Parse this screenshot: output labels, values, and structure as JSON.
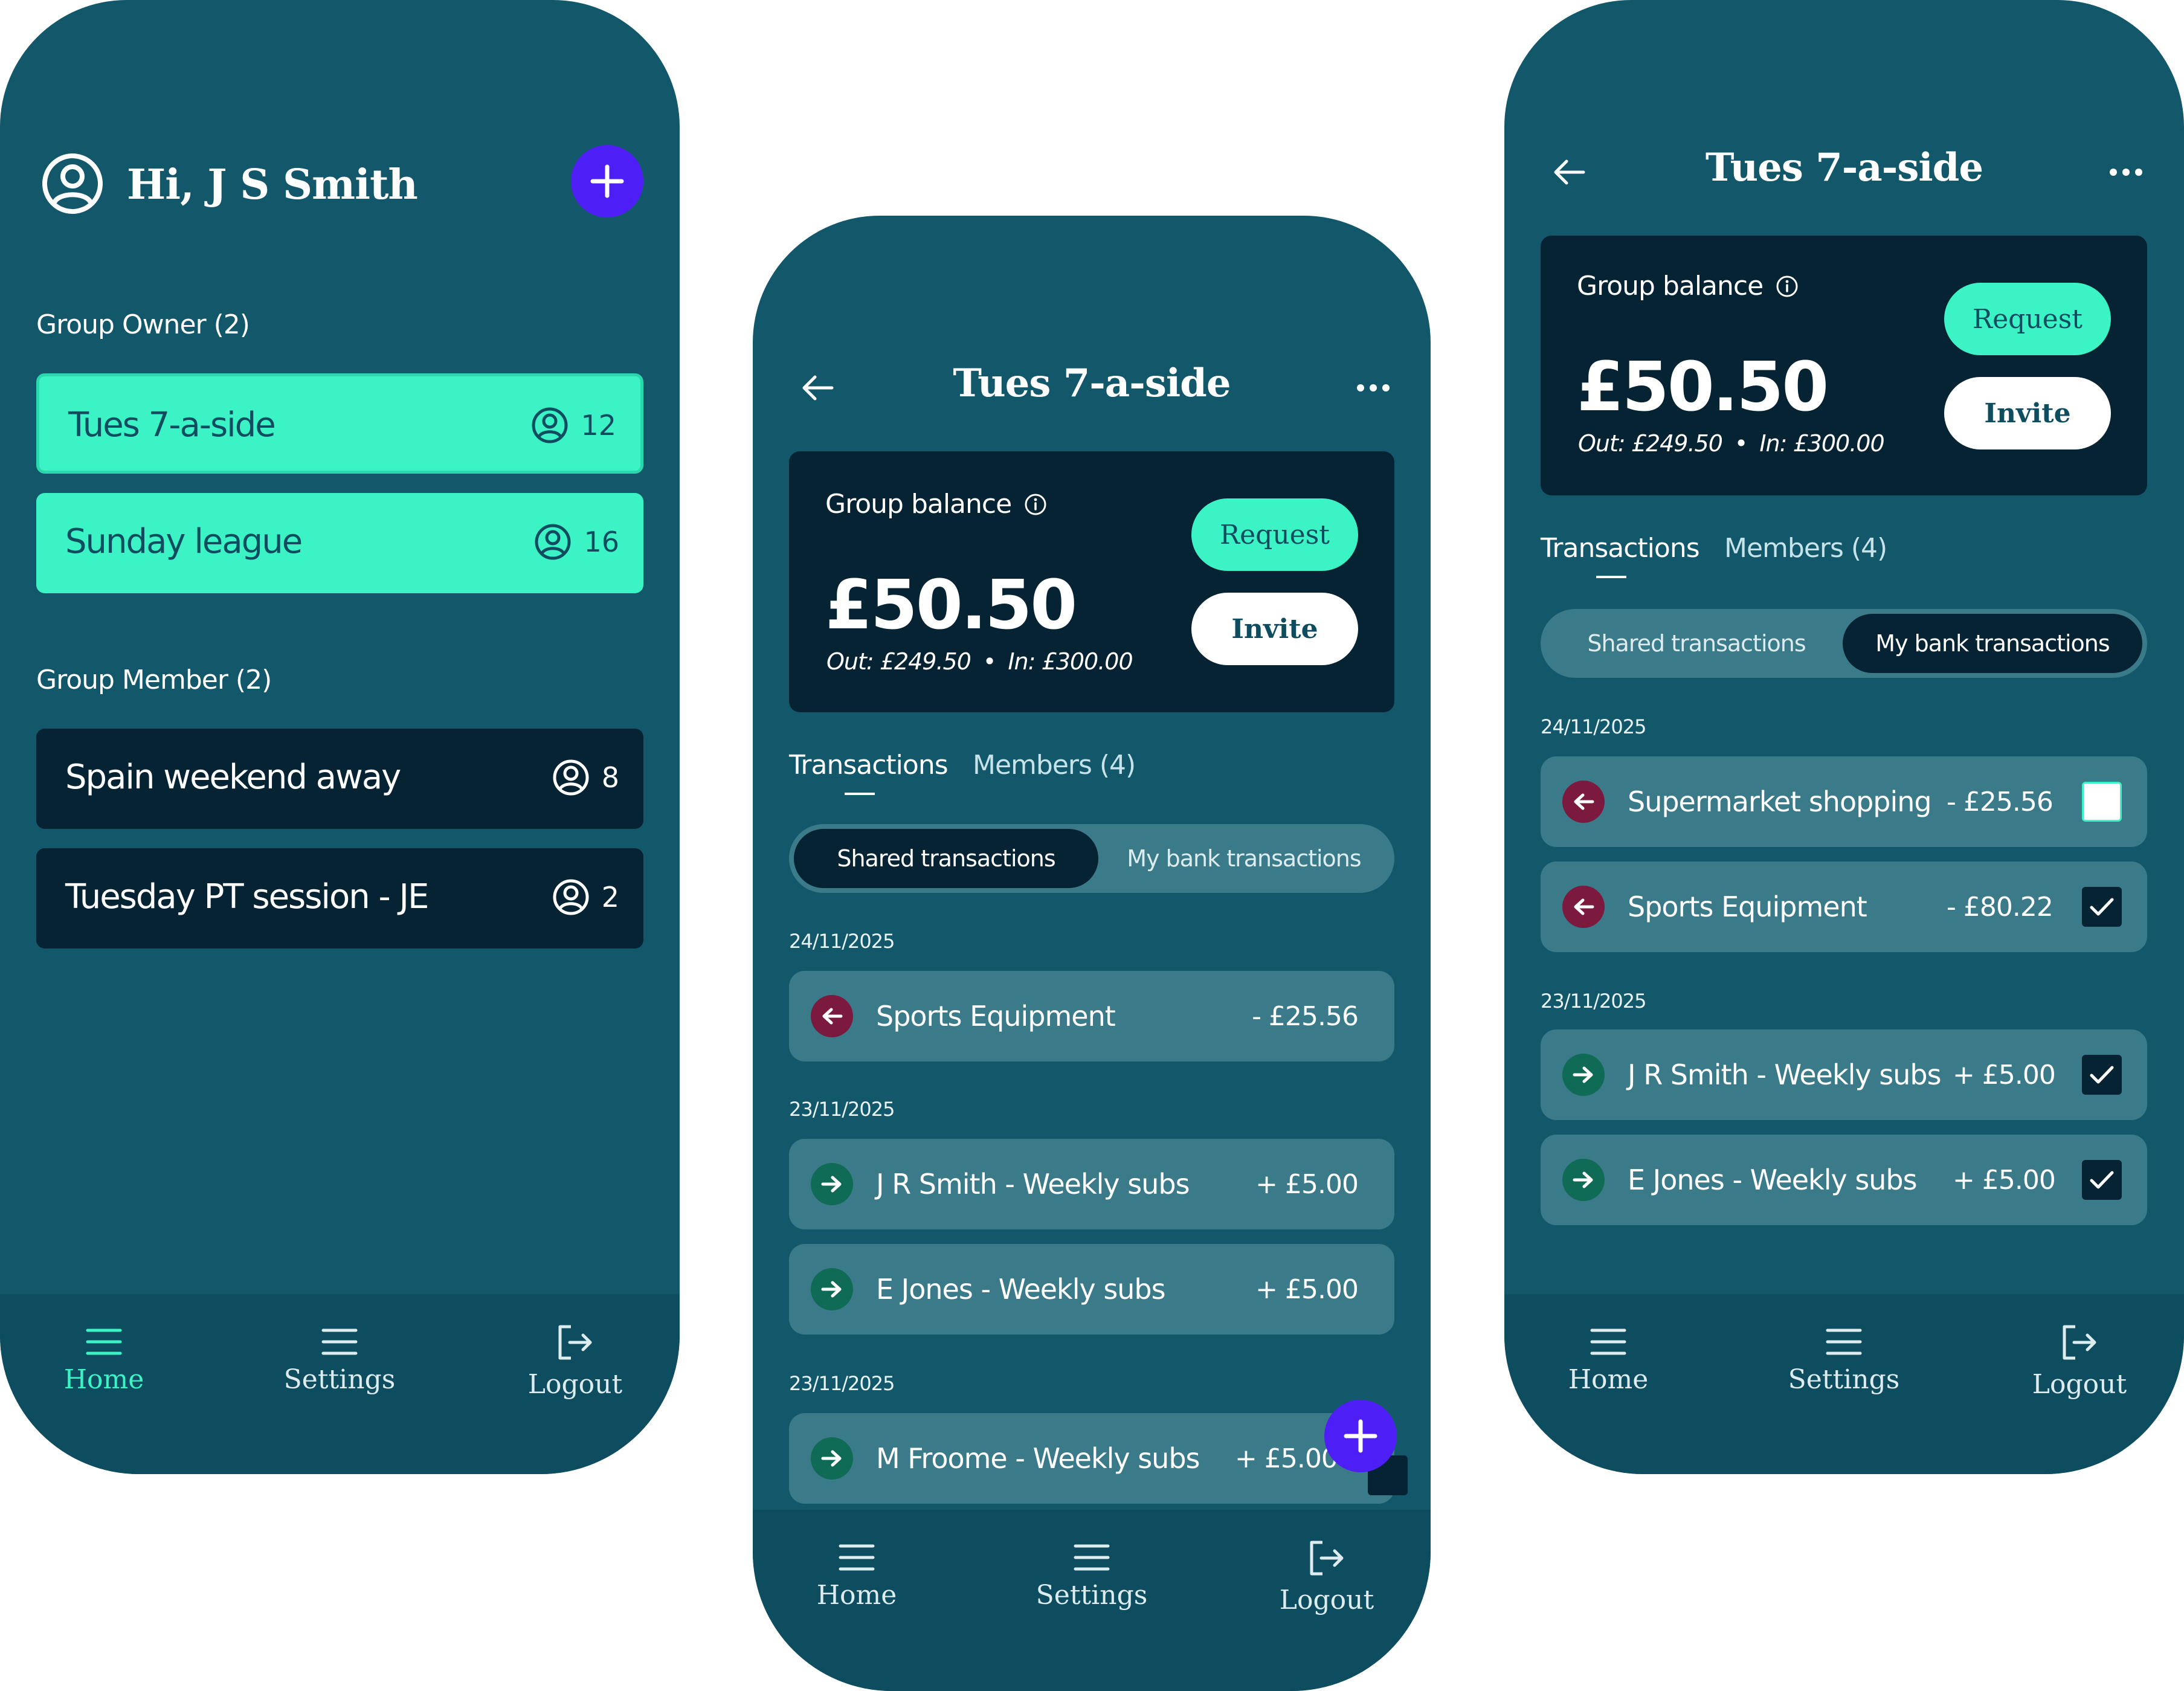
{
  "colors": {
    "screen_bg": "#13576a",
    "nav_bg": "#0d4d5f",
    "card_dark": "#062333",
    "accent_mint": "#3cf3c6",
    "fab_purple": "#4d1ef5",
    "row_bg": "#3b7a89",
    "outgoing": "#7b1a3e",
    "incoming": "#0f6b55"
  },
  "home_screen": {
    "greeting": "Hi, J S Smith",
    "avatar_icon": "user-circle-icon",
    "add_icon": "plus-icon",
    "owner_section": "Group Owner (2)",
    "owner_groups": [
      {
        "name": "Tues 7-a-side",
        "count": "12"
      },
      {
        "name": "Sunday league",
        "count": "16"
      }
    ],
    "member_section": "Group Member (2)",
    "member_groups": [
      {
        "name": "Spain weekend away",
        "count": "8"
      },
      {
        "name": "Tuesday PT session - JE",
        "count": "2"
      }
    ],
    "nav": [
      {
        "label": "Home",
        "icon": "menu-icon",
        "active": true
      },
      {
        "label": "Settings",
        "icon": "menu-icon",
        "active": false
      },
      {
        "label": "Logout",
        "icon": "logout-icon",
        "active": false
      }
    ]
  },
  "shared_screen": {
    "title": "Tues 7-a-side",
    "balance": {
      "label": "Group balance",
      "amount": "£50.50",
      "out": "Out: £249.50",
      "separator": "•",
      "in": "In: £300.00"
    },
    "request_label": "Request",
    "invite_label": "Invite",
    "tabs": [
      "Transactions",
      "Members (4)"
    ],
    "segments": [
      "Shared transactions",
      "My bank transactions"
    ],
    "active_segment": 0,
    "groups": [
      {
        "date": "24/11/2025",
        "items": [
          {
            "name": "Sports Equipment",
            "amount": "- £25.56",
            "direction": "out"
          }
        ]
      },
      {
        "date": "23/11/2025",
        "items": [
          {
            "name": "J R Smith - Weekly subs",
            "amount": "+ £5.00",
            "direction": "in"
          },
          {
            "name": "E Jones - Weekly subs",
            "amount": "+ £5.00",
            "direction": "in"
          }
        ]
      },
      {
        "date": "23/11/2025",
        "items": [
          {
            "name": "M Froome - Weekly subs",
            "amount": "+ £5.00",
            "direction": "in"
          }
        ]
      }
    ],
    "nav": [
      {
        "label": "Home",
        "icon": "menu-icon",
        "active": false
      },
      {
        "label": "Settings",
        "icon": "menu-icon",
        "active": false
      },
      {
        "label": "Logout",
        "icon": "logout-icon",
        "active": false
      }
    ]
  },
  "bank_screen": {
    "title": "Tues 7-a-side",
    "balance": {
      "label": "Group balance",
      "amount": "£50.50",
      "out": "Out: £249.50",
      "separator": "•",
      "in": "In: £300.00"
    },
    "request_label": "Request",
    "invite_label": "Invite",
    "tabs": [
      "Transactions",
      "Members (4)"
    ],
    "segments": [
      "Shared transactions",
      "My bank transactions"
    ],
    "active_segment": 1,
    "groups": [
      {
        "date": "24/11/2025",
        "items": [
          {
            "name": "Supermarket shopping",
            "amount": "- £25.56",
            "direction": "out",
            "checked": false
          },
          {
            "name": "Sports Equipment",
            "amount": "- £80.22",
            "direction": "out",
            "checked": true
          }
        ]
      },
      {
        "date": "23/11/2025",
        "items": [
          {
            "name": "J R Smith - Weekly subs",
            "amount": "+ £5.00",
            "direction": "in",
            "checked": true
          },
          {
            "name": "E Jones - Weekly subs",
            "amount": "+ £5.00",
            "direction": "in",
            "checked": true
          }
        ]
      }
    ],
    "nav": [
      {
        "label": "Home",
        "icon": "menu-icon",
        "active": false
      },
      {
        "label": "Settings",
        "icon": "menu-icon",
        "active": false
      },
      {
        "label": "Logout",
        "icon": "logout-icon",
        "active": false
      }
    ]
  }
}
